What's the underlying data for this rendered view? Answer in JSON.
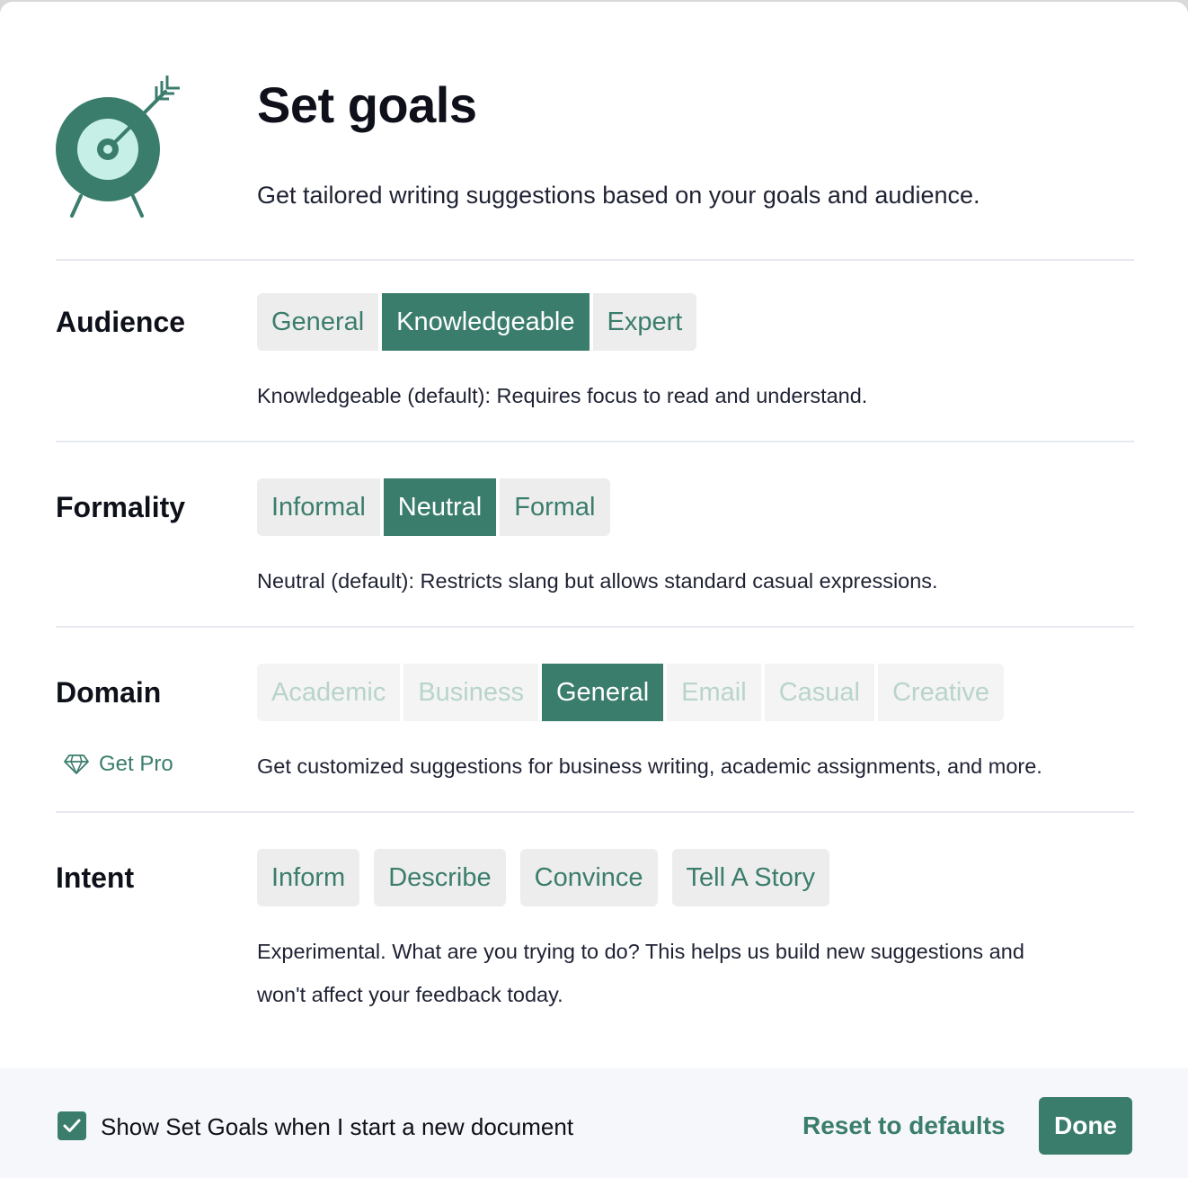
{
  "header": {
    "title": "Set goals",
    "subtitle": "Get tailored writing suggestions based on your goals and audience.",
    "icon": "target-arrow-icon"
  },
  "audience": {
    "label": "Audience",
    "options": [
      "General",
      "Knowledgeable",
      "Expert"
    ],
    "selected": "Knowledgeable",
    "description": "Knowledgeable (default): Requires focus to read and understand."
  },
  "formality": {
    "label": "Formality",
    "options": [
      "Informal",
      "Neutral",
      "Formal"
    ],
    "selected": "Neutral",
    "description": "Neutral (default): Restricts slang but allows standard casual expressions."
  },
  "domain": {
    "label": "Domain",
    "options": [
      "Academic",
      "Business",
      "General",
      "Email",
      "Casual",
      "Creative"
    ],
    "selected": "General",
    "get_pro": "Get Pro",
    "description": "Get customized suggestions for business writing, academic assignments, and more."
  },
  "intent": {
    "label": "Intent",
    "options": [
      "Inform",
      "Describe",
      "Convince",
      "Tell A Story"
    ],
    "description_line1": "Experimental. What are you trying to do? This helps us build new suggestions and",
    "description_line2": "won't affect your feedback today."
  },
  "footer": {
    "checkbox_checked": true,
    "checkbox_label": "Show Set Goals when I start a new document",
    "reset_label": "Reset to defaults",
    "done_label": "Done"
  },
  "colors": {
    "accent": "#3b7d6c",
    "accent_light": "#c6efe7",
    "option_bg": "#ededed",
    "disabled_text": "#b8d4cb"
  }
}
